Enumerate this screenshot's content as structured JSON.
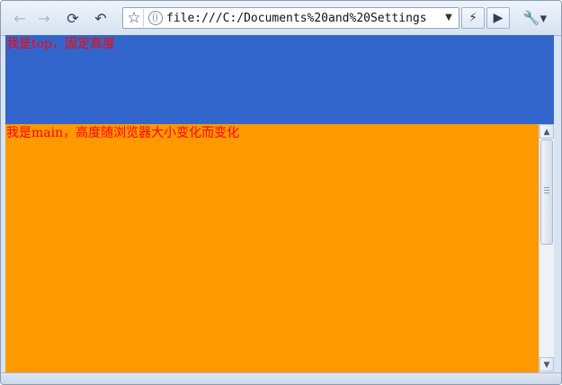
{
  "toolbar": {
    "back_icon": "back-arrow-icon",
    "forward_icon": "forward-arrow-icon",
    "reload_icon": "reload-icon",
    "undo_icon": "undo-icon",
    "bookmark_icon": "star-icon",
    "page_icon": "globe-icon",
    "address_value": "file:///C:/Documents%20and%20Settings",
    "dropdown_icon": "chevron-down-icon",
    "lightning_icon": "lightning-icon",
    "play_icon": "play-icon",
    "wrench_icon": "wrench-icon"
  },
  "page": {
    "top_text": "我是top，固定高度",
    "main_text": "我是main，高度随浏览器大小变化而变化",
    "top_color": "#3366cc",
    "main_color": "#ff9900",
    "text_color": "#ff0000"
  },
  "scrollbar": {
    "up_icon": "scroll-up-arrow-icon",
    "down_icon": "scroll-down-arrow-icon"
  }
}
